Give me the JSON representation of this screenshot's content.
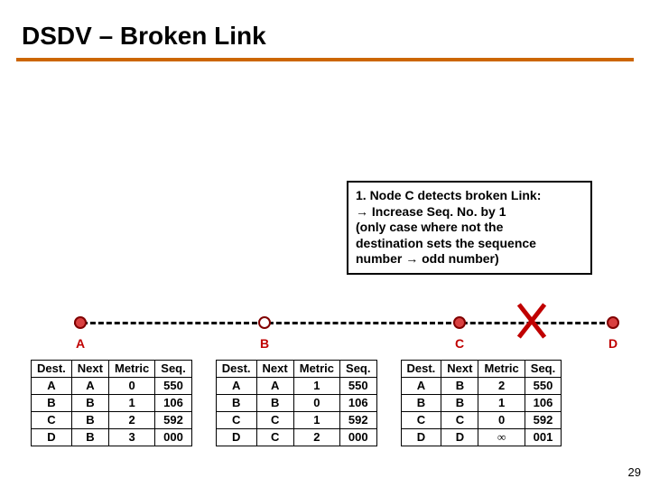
{
  "title": "DSDV – Broken Link",
  "callout": {
    "line1": "1. Node C detects broken Link:",
    "line2": "→ Increase Seq. No. by 1",
    "line3": "(only case where not the",
    "line4": "destination sets the sequence",
    "line5": "number → odd number)"
  },
  "nodes": {
    "A": "A",
    "B": "B",
    "C": "C",
    "D": "D"
  },
  "headers": {
    "dest": "Dest.",
    "next": "Next",
    "metric": "Metric",
    "seq": "Seq."
  },
  "tableA": [
    {
      "dest": "A",
      "next": "A",
      "metric": "0",
      "seq": "550"
    },
    {
      "dest": "B",
      "next": "B",
      "metric": "1",
      "seq": "106"
    },
    {
      "dest": "C",
      "next": "B",
      "metric": "2",
      "seq": "592"
    },
    {
      "dest": "D",
      "next": "B",
      "metric": "3",
      "seq": "000"
    }
  ],
  "tableB": [
    {
      "dest": "A",
      "next": "A",
      "metric": "1",
      "seq": "550"
    },
    {
      "dest": "B",
      "next": "B",
      "metric": "0",
      "seq": "106"
    },
    {
      "dest": "C",
      "next": "C",
      "metric": "1",
      "seq": "592"
    },
    {
      "dest": "D",
      "next": "C",
      "metric": "2",
      "seq": "000"
    }
  ],
  "tableC": [
    {
      "dest": "A",
      "next": "B",
      "metric": "2",
      "seq": "550"
    },
    {
      "dest": "B",
      "next": "B",
      "metric": "1",
      "seq": "106"
    },
    {
      "dest": "C",
      "next": "C",
      "metric": "0",
      "seq": "592"
    },
    {
      "dest": "D",
      "next": "D",
      "metric": "∞",
      "seq": "001"
    }
  ],
  "slidenum": "29"
}
